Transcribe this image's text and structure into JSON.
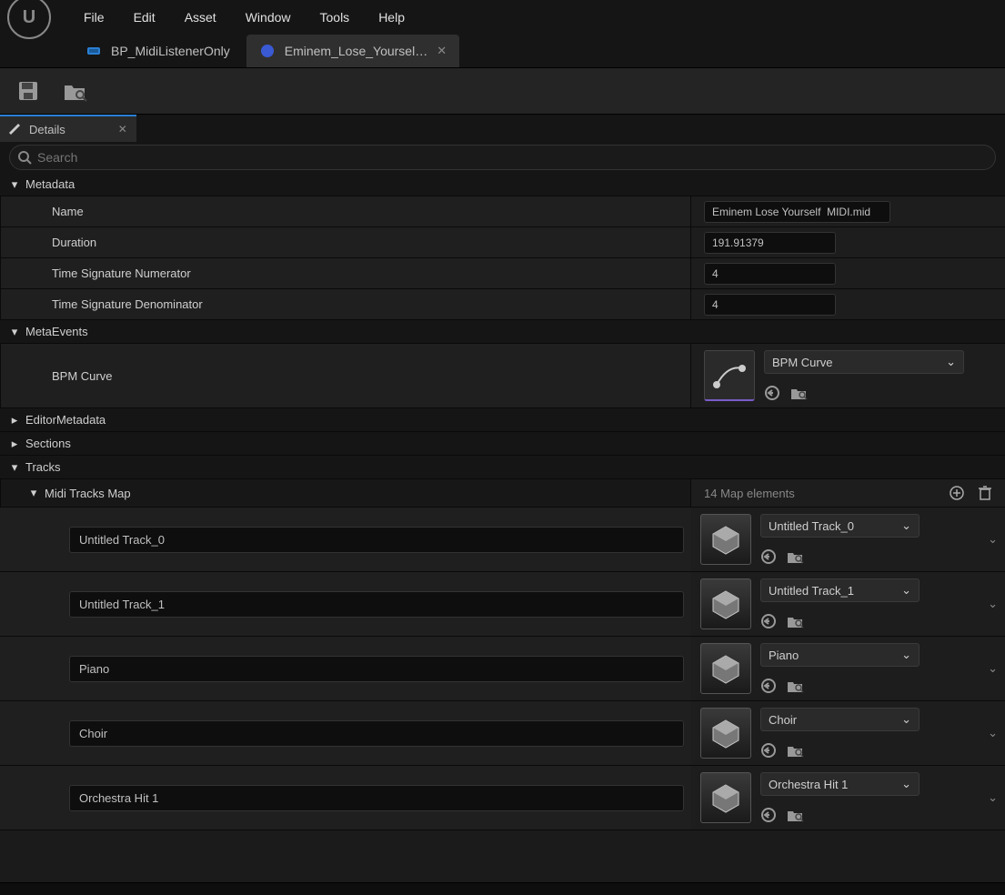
{
  "menu": [
    "File",
    "Edit",
    "Asset",
    "Window",
    "Tools",
    "Help"
  ],
  "tabs": [
    {
      "label": "BP_MidiListenerOnly",
      "active": false,
      "closable": false
    },
    {
      "label": "Eminem_Lose_Yoursel…",
      "active": true,
      "closable": true
    }
  ],
  "detailsPanel": {
    "title": "Details"
  },
  "search": {
    "placeholder": "Search"
  },
  "categories": {
    "metadata": {
      "title": "Metadata",
      "rows": {
        "name": {
          "label": "Name",
          "value": "Eminem Lose Yourself  MIDI.mid"
        },
        "duration": {
          "label": "Duration",
          "value": "191.91379"
        },
        "tsn": {
          "label": "Time Signature Numerator",
          "value": "4"
        },
        "tsd": {
          "label": "Time Signature Denominator",
          "value": "4"
        }
      }
    },
    "metaevents": {
      "title": "MetaEvents",
      "bpm": {
        "label": "BPM Curve",
        "dropdown": "BPM Curve"
      }
    },
    "editorMetadata": {
      "title": "EditorMetadata"
    },
    "sections": {
      "title": "Sections"
    },
    "tracks": {
      "title": "Tracks",
      "mapHeader": "Midi Tracks Map",
      "mapCount": "14 Map elements",
      "items": [
        {
          "key": "Untitled Track_0",
          "value": "Untitled Track_0"
        },
        {
          "key": "Untitled Track_1",
          "value": "Untitled Track_1"
        },
        {
          "key": "Piano",
          "value": "Piano"
        },
        {
          "key": "Choir",
          "value": "Choir"
        },
        {
          "key": "Orchestra Hit 1",
          "value": "Orchestra Hit 1"
        }
      ]
    }
  }
}
